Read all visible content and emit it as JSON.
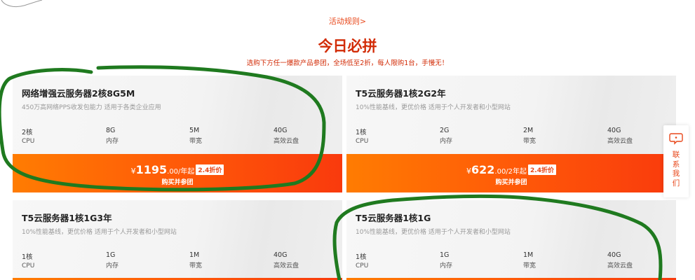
{
  "header": {
    "rules_link": "活动规则>",
    "title": "今日必拼",
    "subtitle": "选购下方任一爆款产品参团，全场低至2折，每人限购1台，手慢无！"
  },
  "products": [
    {
      "name": "网络增强云服务器2核8G5M",
      "desc": "450万高网络PPS收发包能力 适用于各类企业应用",
      "specs": [
        {
          "value": "2核",
          "label": "CPU"
        },
        {
          "value": "8G",
          "label": "内存"
        },
        {
          "value": "5M",
          "label": "带宽"
        },
        {
          "value": "40G",
          "label": "高效云盘"
        }
      ],
      "price_symbol": "¥",
      "price": "1195",
      "price_unit": ".00/年起",
      "discount": "2.4折价",
      "buy_label": "购买并参团"
    },
    {
      "name": "T5云服务器1核2G2年",
      "desc": "10%性能基线，更优价格 适用于个人开发者和小型网站",
      "specs": [
        {
          "value": "1核",
          "label": "CPU"
        },
        {
          "value": "2G",
          "label": "内存"
        },
        {
          "value": "2M",
          "label": "带宽"
        },
        {
          "value": "40G",
          "label": "高效云盘"
        }
      ],
      "price_symbol": "¥",
      "price": "622",
      "price_unit": ".00/2年起",
      "discount": "2.4折价",
      "buy_label": "购买并参团"
    },
    {
      "name": "T5云服务器1核1G3年",
      "desc": "10%性能基线，更优价格 适用于个人开发者和小型网站",
      "specs": [
        {
          "value": "1核",
          "label": "CPU"
        },
        {
          "value": "1G",
          "label": "内存"
        },
        {
          "value": "1M",
          "label": "带宽"
        },
        {
          "value": "40G",
          "label": "高效云盘"
        }
      ]
    },
    {
      "name": "T5云服务器1核1G",
      "desc": "10%性能基线，更优价格 适用于个人开发者和小型网站",
      "specs": [
        {
          "value": "1核",
          "label": "CPU"
        },
        {
          "value": "1G",
          "label": "内存"
        },
        {
          "value": "1M",
          "label": "带宽"
        },
        {
          "value": "40G",
          "label": "高效云盘"
        }
      ]
    }
  ],
  "contact_button": {
    "label": "联系我们",
    "icon": "chat-bubble-icon"
  },
  "colors": {
    "accent": "#e8471a",
    "title_red": "#d22b06",
    "bar_start": "#ff7c02",
    "bar_end": "#f93a0d",
    "ink_green": "#1f7a1f"
  }
}
